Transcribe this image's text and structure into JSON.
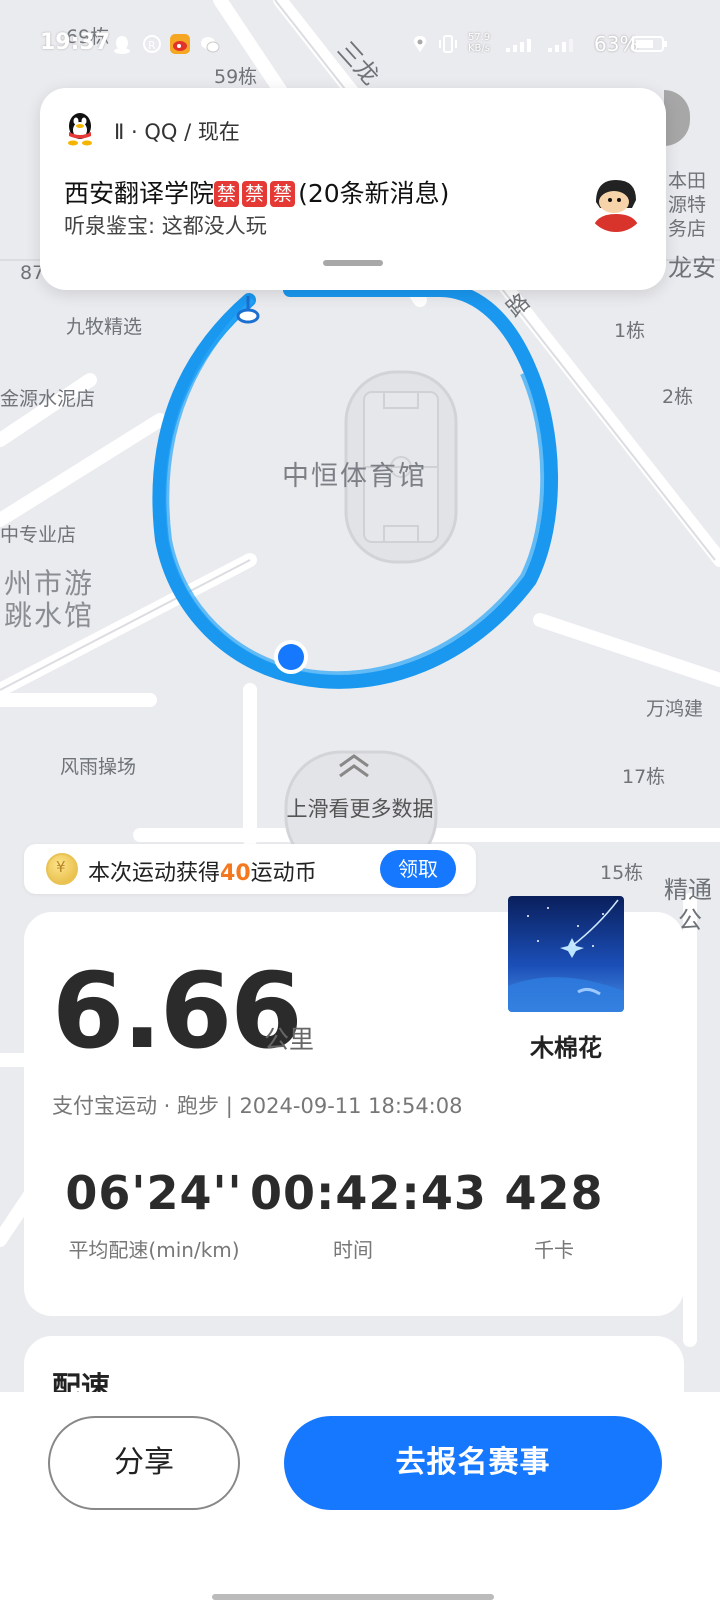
{
  "status_bar": {
    "time": "19:37",
    "network_speed": "57.9\nKB/s",
    "battery": "63%"
  },
  "map": {
    "labels": {
      "building_69": "69栋",
      "building_59": "59栋",
      "road_top": "三龙",
      "num_87": "87",
      "jiumu": "九牧精选",
      "jinyuan": "金源水泥店",
      "gym": "中恒体育馆",
      "zhuanye": "中专业店",
      "swim_1": "州市游",
      "swim_2": "跳水馆",
      "fengyu": "风雨操场",
      "building_1": "1栋",
      "building_2": "2栋",
      "road_right": "路",
      "benti_1": "本田",
      "benti_2": "源特",
      "benti_3": "务店",
      "longan": "龙安",
      "wanhong": "万鸿建",
      "building_17": "17栋",
      "building_15": "15栋",
      "jing_1": "精通",
      "jing_2": "公"
    }
  },
  "notification": {
    "header": "Ⅱ · QQ / 现在",
    "title_prefix": "西安翻译学院",
    "title_tag": "禁",
    "title_suffix": "(20条新消息)",
    "body": "听泉鉴宝: 这都没人玩"
  },
  "swipe_hint": "上滑看更多数据",
  "coin": {
    "icon": "coin-icon",
    "prefix": "本次运动获得",
    "amount": "40",
    "suffix": "运动币",
    "claim_label": "领取"
  },
  "stats": {
    "distance": "6.66",
    "distance_unit": "公里",
    "meta": "支付宝运动 · 跑步 | 2024-09-11 18:54:08",
    "song_title": "木棉花",
    "metrics": [
      {
        "value": "06'24''",
        "label": "平均配速(min/km)"
      },
      {
        "value": "00:42:43",
        "label": "时间"
      },
      {
        "value": "428",
        "label": "千卡"
      }
    ]
  },
  "pace_card": {
    "title": "配速"
  },
  "bottom": {
    "share_label": "分享",
    "signup_label": "去报名赛事"
  },
  "colors": {
    "accent": "#1677ff",
    "route": "#1a98f0",
    "coin_amount": "#f5781f"
  }
}
